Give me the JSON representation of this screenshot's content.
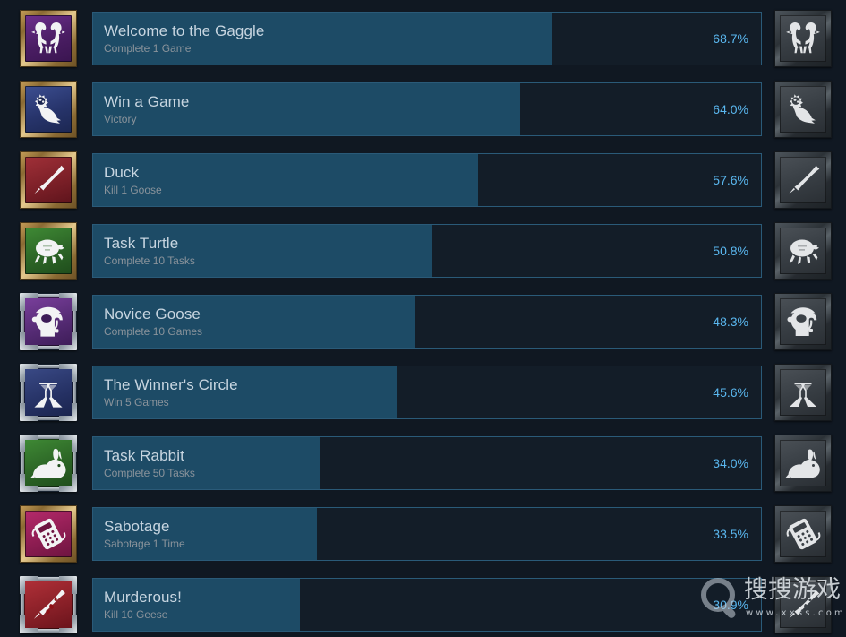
{
  "page": {
    "title": "Steam Global Achievement Stats",
    "background_color": "#101822",
    "bar_track_color": "#131d28",
    "bar_fill_color": "#1d4b66",
    "bar_border_color": "#2a5a78",
    "percent_color": "#5ab7ef",
    "title_color": "#c7d5e0",
    "desc_color": "#8a939b"
  },
  "achievements": [
    {
      "title": "Welcome to the Gaggle",
      "description": "Complete 1 Game",
      "percent_label": "68.7%",
      "percent_value": 68.7,
      "icon_name": "two-geese-icon",
      "frame": "gold",
      "art_bg": "bg-purple"
    },
    {
      "title": "Win a Game",
      "description": "Victory",
      "percent_label": "64.0%",
      "percent_value": 64.0,
      "icon_name": "goose-gear-icon",
      "frame": "gold",
      "art_bg": "bg-navy"
    },
    {
      "title": "Duck",
      "description": "Kill 1 Goose",
      "percent_label": "57.6%",
      "percent_value": 57.6,
      "icon_name": "knife-icon",
      "frame": "gold",
      "art_bg": "bg-red"
    },
    {
      "title": "Task Turtle",
      "description": "Complete 10 Tasks",
      "percent_label": "50.8%",
      "percent_value": 50.8,
      "icon_name": "turtle-icon",
      "frame": "gold",
      "art_bg": "bg-green"
    },
    {
      "title": "Novice Goose",
      "description": "Complete 10 Games",
      "percent_label": "48.3%",
      "percent_value": 48.3,
      "icon_name": "goose-helmet-icon",
      "frame": "silver",
      "art_bg": "bg-purple2"
    },
    {
      "title": "The Winner's Circle",
      "description": "Win 5 Games",
      "percent_label": "45.6%",
      "percent_value": 45.6,
      "icon_name": "toasting-glasses-icon",
      "frame": "silver",
      "art_bg": "bg-navy2"
    },
    {
      "title": "Task Rabbit",
      "description": "Complete 50 Tasks",
      "percent_label": "34.0%",
      "percent_value": 34.0,
      "icon_name": "rabbit-icon",
      "frame": "silver",
      "art_bg": "bg-green"
    },
    {
      "title": "Sabotage",
      "description": "Sabotage 1 Time",
      "percent_label": "33.5%",
      "percent_value": 33.5,
      "icon_name": "sabotage-device-icon",
      "frame": "gold",
      "art_bg": "bg-magenta"
    },
    {
      "title": "Murderous!",
      "description": "Kill 10 Geese",
      "percent_label": "30.9%",
      "percent_value": 30.9,
      "icon_name": "bloody-knife-icon",
      "frame": "silver",
      "art_bg": "bg-red2"
    }
  ],
  "watermark": {
    "icon_name": "magnifier-icon",
    "text_cn": "搜搜游戏",
    "url": "www.xxss.com"
  }
}
